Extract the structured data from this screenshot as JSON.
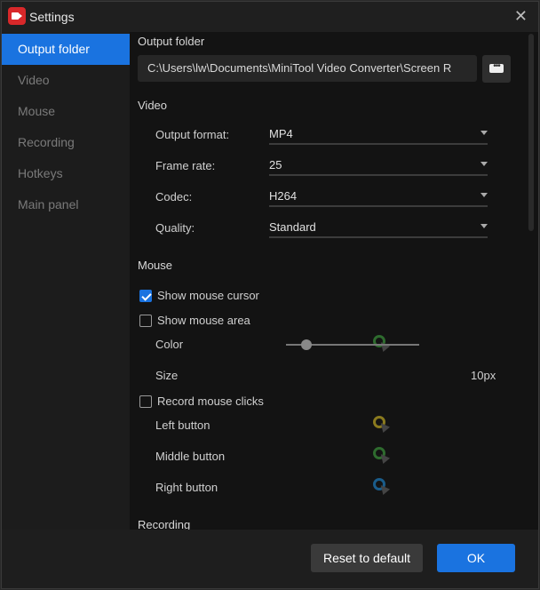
{
  "window": {
    "title": "Settings"
  },
  "sidebar": {
    "items": [
      {
        "label": "Output folder",
        "active": true
      },
      {
        "label": "Video"
      },
      {
        "label": "Mouse"
      },
      {
        "label": "Recording"
      },
      {
        "label": "Hotkeys"
      },
      {
        "label": "Main panel"
      }
    ]
  },
  "output": {
    "heading": "Output folder",
    "path": "C:\\Users\\lw\\Documents\\MiniTool Video Converter\\Screen R",
    "browse_label": "•••"
  },
  "video": {
    "heading": "Video",
    "fields": [
      {
        "label": "Output format:",
        "value": "MP4"
      },
      {
        "label": "Frame rate:",
        "value": "25"
      },
      {
        "label": "Codec:",
        "value": "H264"
      },
      {
        "label": "Quality:",
        "value": "Standard"
      }
    ]
  },
  "mouse": {
    "heading": "Mouse",
    "show_cursor": {
      "label": "Show mouse cursor",
      "checked": true
    },
    "show_area": {
      "label": "Show mouse area",
      "checked": false
    },
    "color_label": "Color",
    "size_label": "Size",
    "size_value": "10px",
    "size_fraction": 0.15,
    "record_clicks": {
      "label": "Record mouse clicks",
      "checked": false
    },
    "buttons": [
      {
        "label": "Left button",
        "color": "#8a7a1e"
      },
      {
        "label": "Middle button",
        "color": "#2e6b2e"
      },
      {
        "label": "Right button",
        "color": "#1a5c8a"
      }
    ],
    "area_color": "#2e6b2e"
  },
  "recording": {
    "heading": "Recording"
  },
  "footer": {
    "reset_label": "Reset to default",
    "ok_label": "OK"
  }
}
